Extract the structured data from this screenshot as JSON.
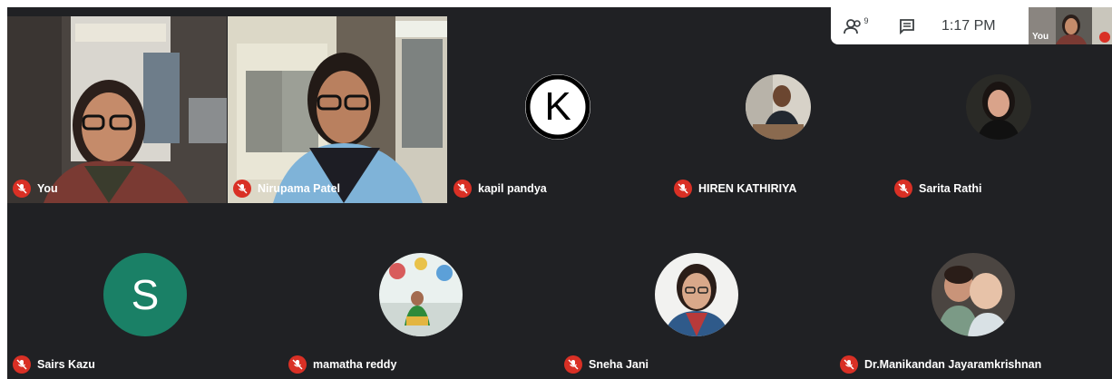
{
  "top_bar": {
    "participants_count": "9",
    "time": "1:17 PM",
    "self_view_label": "You"
  },
  "participants": [
    {
      "name": "You",
      "muted": true,
      "video": true
    },
    {
      "name": "Nirupama Patel",
      "muted": true,
      "video": true
    },
    {
      "name": "kapil pandya",
      "muted": true,
      "avatar_letter": "K"
    },
    {
      "name": "HIREN KATHIRIYA",
      "muted": true,
      "avatar": "photo"
    },
    {
      "name": "Sarita Rathi",
      "muted": true,
      "avatar": "photo"
    },
    {
      "name": "Sairs Kazu",
      "muted": true,
      "avatar_letter": "S"
    },
    {
      "name": "mamatha reddy",
      "muted": true,
      "avatar": "photo"
    },
    {
      "name": "Sneha Jani",
      "muted": true,
      "avatar": "photo"
    },
    {
      "name": "Dr.Manikandan Jayaramkrishnan",
      "muted": true,
      "avatar": "photo"
    }
  ],
  "colors": {
    "stage_bg": "#202124",
    "mic_off": "#d93025",
    "avatar_s": "#1a8066",
    "topbar_bg": "#ffffff"
  },
  "icons": {
    "people": "people-icon",
    "chat": "chat-icon",
    "mic_off": "mic-off-icon"
  }
}
